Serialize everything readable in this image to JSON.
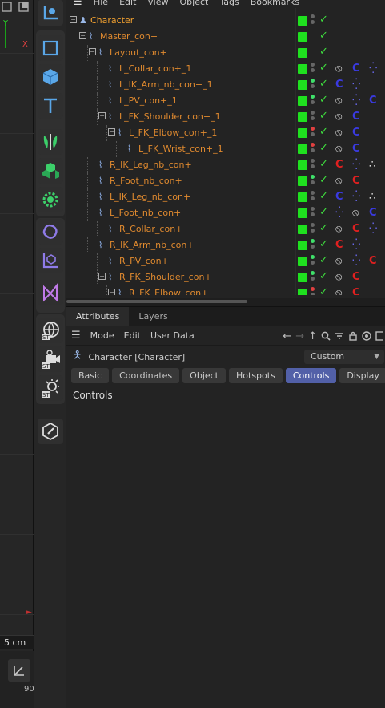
{
  "viewport": {
    "axis_y_label": "Y",
    "axis_x_label": "X",
    "scale_label": "5 cm",
    "bottom_number": "90"
  },
  "toolbar": {
    "tools": [
      "select-icon",
      "cube-outline-icon",
      "cube-icon",
      "text-tool-icon",
      "symmetry-icon",
      "cloner-icon",
      "gear-effector-icon",
      "spline-icon",
      "axis-cube-icon",
      "deformer-icon",
      "scene-st-icon",
      "camera-st-icon",
      "light-st-icon",
      "edit-icon"
    ]
  },
  "object_manager": {
    "menu": [
      "File",
      "Edit",
      "View",
      "Object",
      "Tags",
      "Bookmarks"
    ],
    "rows": [
      {
        "name": "Character",
        "depth": 0,
        "type": "character",
        "expander": "minus",
        "dots": "gray",
        "tags": []
      },
      {
        "name": "Master_con+",
        "depth": 1,
        "type": "spline",
        "expander": "minus",
        "dots": "none",
        "tags": []
      },
      {
        "name": "Layout_con+",
        "depth": 2,
        "type": "spline",
        "expander": "minus",
        "dots": "none",
        "tags": []
      },
      {
        "name": "L_Collar_con+_1",
        "depth": 3,
        "type": "spline",
        "expander": "none",
        "dots": "gray",
        "tags": [
          "ban",
          "C-blue",
          "dots-blue"
        ]
      },
      {
        "name": "L_IK_Arm_nb_con+_1",
        "depth": 3,
        "type": "spline",
        "expander": "none",
        "dots": "green",
        "tags": [
          "C-blue",
          "dots-blue"
        ]
      },
      {
        "name": "L_PV_con+_1",
        "depth": 3,
        "type": "spline",
        "expander": "none",
        "dots": "green",
        "tags": [
          "ban",
          "dots-blue",
          "C-blue"
        ]
      },
      {
        "name": "L_FK_Shoulder_con+_1",
        "depth": 3,
        "type": "spline",
        "expander": "minus",
        "dots": "gray",
        "tags": [
          "ban",
          "C-blue"
        ]
      },
      {
        "name": "L_FK_Elbow_con+_1",
        "depth": 4,
        "type": "spline",
        "expander": "minus",
        "dots": "red",
        "tags": [
          "ban",
          "C-blue"
        ]
      },
      {
        "name": "L_FK_Wrist_con+_1",
        "depth": 5,
        "type": "spline",
        "expander": "none",
        "dots": "red",
        "tags": [
          "ban",
          "C-blue"
        ]
      },
      {
        "name": "R_IK_Leg_nb_con+",
        "depth": 2,
        "type": "spline",
        "expander": "none",
        "dots": "gray",
        "tags": [
          "C-red",
          "dots-blue",
          "dots-white"
        ]
      },
      {
        "name": "R_Foot_nb_con+",
        "depth": 2,
        "type": "spline",
        "expander": "none",
        "dots": "green",
        "tags": [
          "ban",
          "C-red"
        ]
      },
      {
        "name": "L_IK_Leg_nb_con+",
        "depth": 2,
        "type": "spline",
        "expander": "none",
        "dots": "gray",
        "tags": [
          "C-blue",
          "dots-blue",
          "dots-white"
        ]
      },
      {
        "name": "L_Foot_nb_con+",
        "depth": 2,
        "type": "spline",
        "expander": "none",
        "dots": "gray",
        "tags": [
          "dots-blue",
          "ban",
          "C-blue"
        ]
      },
      {
        "name": "R_Collar_con+",
        "depth": 3,
        "type": "spline",
        "expander": "none",
        "dots": "gray",
        "tags": [
          "ban",
          "C-red",
          "dots-blue"
        ]
      },
      {
        "name": "R_IK_Arm_nb_con+",
        "depth": 2,
        "type": "spline",
        "expander": "none",
        "dots": "green",
        "tags": [
          "C-red",
          "dots-blue"
        ]
      },
      {
        "name": "R_PV_con+",
        "depth": 3,
        "type": "spline",
        "expander": "none",
        "dots": "green",
        "tags": [
          "ban",
          "dots-blue",
          "C-red"
        ]
      },
      {
        "name": "R_FK_Shoulder_con+",
        "depth": 3,
        "type": "spline",
        "expander": "minus",
        "dots": "green",
        "tags": [
          "ban",
          "C-red"
        ]
      },
      {
        "name": "R_FK_Elbow_con+",
        "depth": 4,
        "type": "spline",
        "expander": "minus",
        "dots": "red",
        "tags": [
          "ban",
          "C-red"
        ]
      }
    ]
  },
  "attributes": {
    "tabs": [
      "Attributes",
      "Layers"
    ],
    "menu": [
      "Mode",
      "Edit",
      "User Data"
    ],
    "object_label": "Character [Character]",
    "mode_value": "Custom",
    "buttons": [
      "Basic",
      "Coordinates",
      "Object",
      "Hotspots",
      "Controls",
      "Display"
    ],
    "active_button": "Controls",
    "group_title": "Controls"
  },
  "colors": {
    "accent": "#5260a8",
    "name_orange": "#e08a2f",
    "enabled_green": "#1fe01f",
    "tag_blue": "#3a3ae0",
    "tag_red": "#e02020"
  }
}
